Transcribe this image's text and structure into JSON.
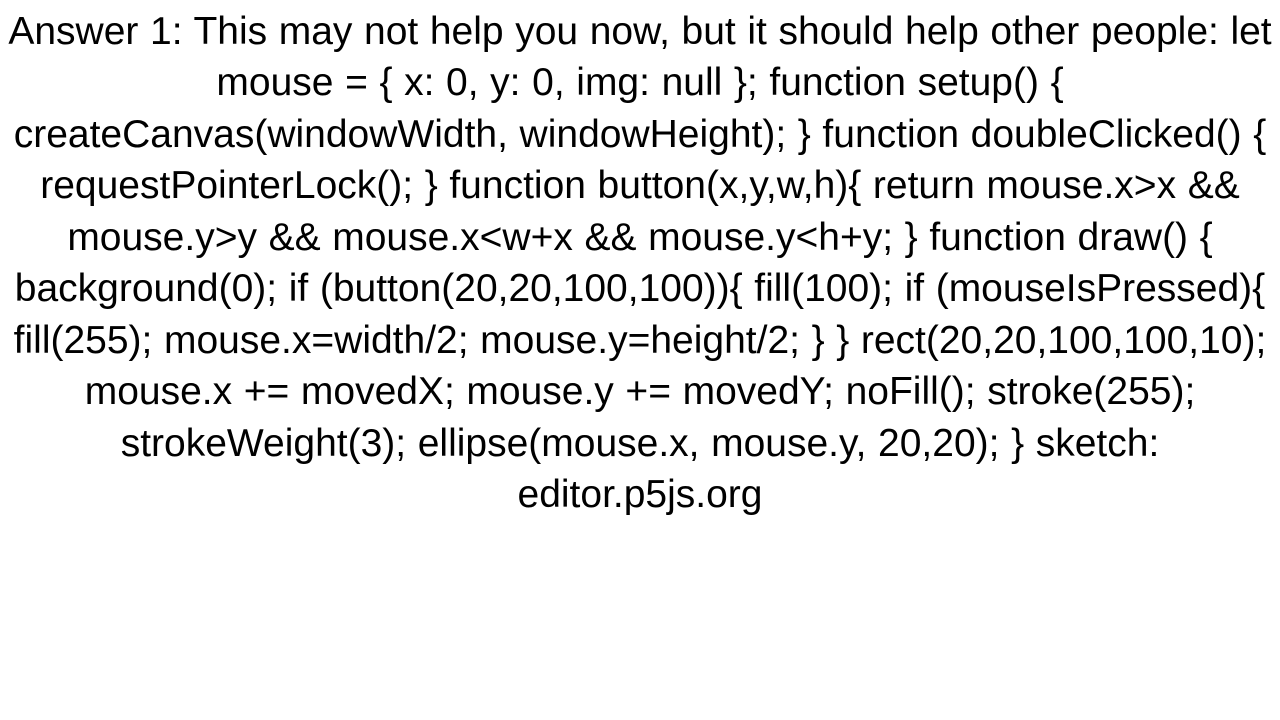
{
  "answer": {
    "text": "Answer 1: This may not help you now, but it should help other people: let mouse = {     x: 0,     y: 0,     img: null }; function setup() {     createCanvas(windowWidth, windowHeight); } function doubleClicked() {     requestPointerLock(); } function button(x,y,w,h){     return mouse.x>x && mouse.y>y && mouse.x<w+x && mouse.y<h+y; } function draw() {     background(0);     if (button(20,20,100,100)){         fill(100);         if (mouseIsPressed){             fill(255);             mouse.x=width/2;             mouse.y=height/2;         }     }     rect(20,20,100,100,10);     mouse.x += movedX;     mouse.y += movedY;     noFill();     stroke(255);     strokeWeight(3);     ellipse(mouse.x, mouse.y, 20,20); } sketch: editor.p5js.org"
  }
}
